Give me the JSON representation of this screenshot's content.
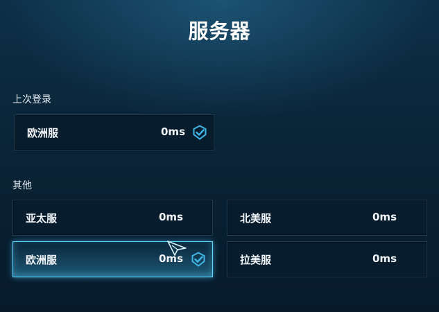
{
  "page": {
    "title": "服务器"
  },
  "last_login": {
    "label": "上次登录",
    "server": {
      "name": "欧洲服",
      "ping": "0ms",
      "selected": true
    }
  },
  "others": {
    "label": "其他",
    "servers": [
      {
        "name": "亚太服",
        "ping": "0ms",
        "selected": false
      },
      {
        "name": "北美服",
        "ping": "0ms",
        "selected": false
      },
      {
        "name": "欧洲服",
        "ping": "0ms",
        "selected": true
      },
      {
        "name": "拉美服",
        "ping": "0ms",
        "selected": false
      }
    ]
  },
  "icons": {
    "check": "check-shield-icon",
    "cursor": "arrow-cursor-icon"
  },
  "colors": {
    "accent": "#5fd8ff",
    "check": "#3fb6e8"
  }
}
